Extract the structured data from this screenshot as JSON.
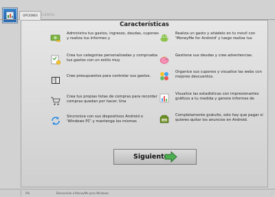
{
  "window": {
    "title": ""
  },
  "tabs": [
    {
      "label": "OPCIONES"
    },
    {
      "label": "CUENTAS"
    }
  ],
  "content": {
    "title": "Características",
    "features": [
      {
        "icon": "money-icon",
        "text": "Administra tus gastos, ingresos, deudas, cupones y realiza tus informes y"
      },
      {
        "icon": "android-icon",
        "text": "Realiza un gasto y añádelo en tu móvil con 'MoneyMe for Android' y luego realiza tus"
      },
      {
        "icon": "category-icon",
        "text": "Crea tus categorías personalizadas y comprueba tus gastos con un estilo muy"
      },
      {
        "icon": "piggy-bank-icon",
        "text": "Gestione sus deudas y cree advertencias."
      },
      {
        "icon": "book-icon",
        "text": "Cree presupuestos para controlar sus gastos."
      },
      {
        "icon": "web-icon",
        "text": "Organice sus cupones y visualice las webs con mejores descuentos."
      },
      {
        "icon": "cart-icon",
        "text": "Crea tus propias listas de compras para recordar compras quedan por hacer. Una"
      },
      {
        "icon": "chart-icon",
        "text": "Visualice las estadísticas con impresionantes gráficos a tu medida y genere informes de"
      },
      {
        "icon": "sync-icon",
        "text": "Sincronice con sus dispositivos Android o 'Windows PC' y mantenga los mismos"
      },
      {
        "icon": "free-icon",
        "text": "Completamente gratuito, sólo hay que pagar si quieres quitar los anuncios en Android."
      }
    ]
  },
  "next_button": {
    "label": "Siguiente"
  },
  "status": {
    "percent": "0%",
    "message": "Bienvenido a MoneyMe para Windows"
  }
}
